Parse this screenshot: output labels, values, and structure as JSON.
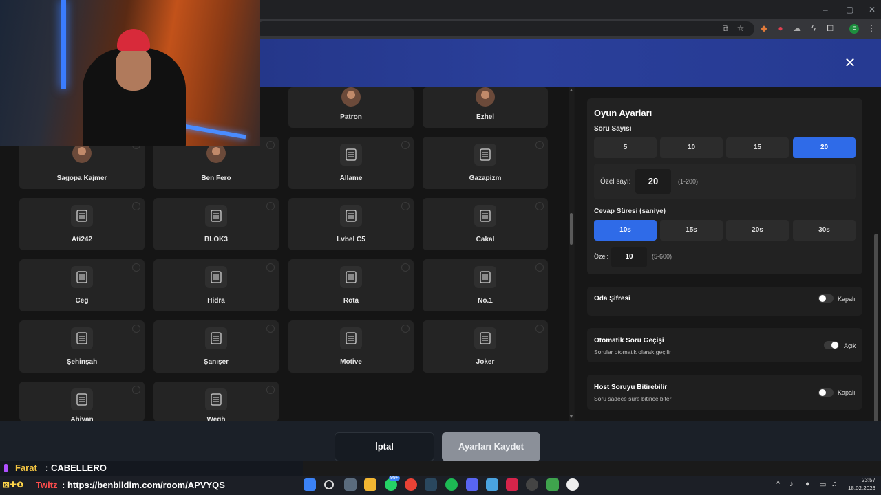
{
  "window": {
    "minimize": "–",
    "maximize": "▢",
    "close": "✕"
  },
  "browser": {
    "profile_initial": "F"
  },
  "modal": {
    "close_glyph": "✕"
  },
  "cards": [
    {
      "name": "Patron",
      "avatar": true
    },
    {
      "name": "Ezhel",
      "avatar": true
    },
    {
      "name": "Sagopa Kajmer",
      "avatar": true
    },
    {
      "name": "Ben Fero",
      "avatar": true
    },
    {
      "name": "Allame",
      "avatar": false
    },
    {
      "name": "Gazapizm",
      "avatar": false
    },
    {
      "name": "Ati242",
      "avatar": false
    },
    {
      "name": "BLOK3",
      "avatar": false
    },
    {
      "name": "Lvbel C5",
      "avatar": false
    },
    {
      "name": "Cakal",
      "avatar": false
    },
    {
      "name": "Ceg",
      "avatar": false
    },
    {
      "name": "Hidra",
      "avatar": false
    },
    {
      "name": "Rota",
      "avatar": false
    },
    {
      "name": "No.1",
      "avatar": false
    },
    {
      "name": "Şehinşah",
      "avatar": false
    },
    {
      "name": "Şanışer",
      "avatar": false
    },
    {
      "name": "Motive",
      "avatar": false
    },
    {
      "name": "Joker",
      "avatar": false
    },
    {
      "name": "Ahiyan",
      "avatar": false
    },
    {
      "name": "Wegh",
      "avatar": false
    }
  ],
  "settings": {
    "title": "Oyun Ayarları",
    "question_count": {
      "label": "Soru Sayısı",
      "options": [
        "5",
        "10",
        "15",
        "20"
      ],
      "selected": "20",
      "custom_label": "Özel sayı:",
      "custom_value": "20",
      "custom_hint": "(1-200)"
    },
    "answer_time": {
      "label": "Cevap Süresi (saniye)",
      "options": [
        "10s",
        "15s",
        "20s",
        "30s"
      ],
      "selected": "10s",
      "custom_label": "Özel:",
      "custom_value": "10",
      "custom_hint": "(5-600)"
    },
    "room_password": {
      "title": "Oda Şifresi",
      "state": "Kapalı",
      "on": false
    },
    "auto_advance": {
      "title": "Otomatik Soru Geçişi",
      "subtitle": "Sorular otomatik olarak geçilir",
      "state": "Açık",
      "on": true
    },
    "host_end": {
      "title": "Host Soruyu Bitirebilir",
      "subtitle": "Soru sadece süre bitince biter",
      "state": "Kapalı",
      "on": false
    }
  },
  "footer": {
    "cancel_label": "İptal",
    "save_label": "Ayarları Kaydet"
  },
  "stream": {
    "chat_user": "Farat",
    "chat_message": ": CABELLERO",
    "badge": "⊠✚❶",
    "twitz_label": "Twitz",
    "twitz_link": ": https://benbildim.com/room/APVYQS"
  },
  "taskbar": {
    "time": "23:57",
    "date": "18.02.2026",
    "badge_count": "99+"
  },
  "colors": {
    "accent": "#2f6be8",
    "header": "#24378f"
  }
}
